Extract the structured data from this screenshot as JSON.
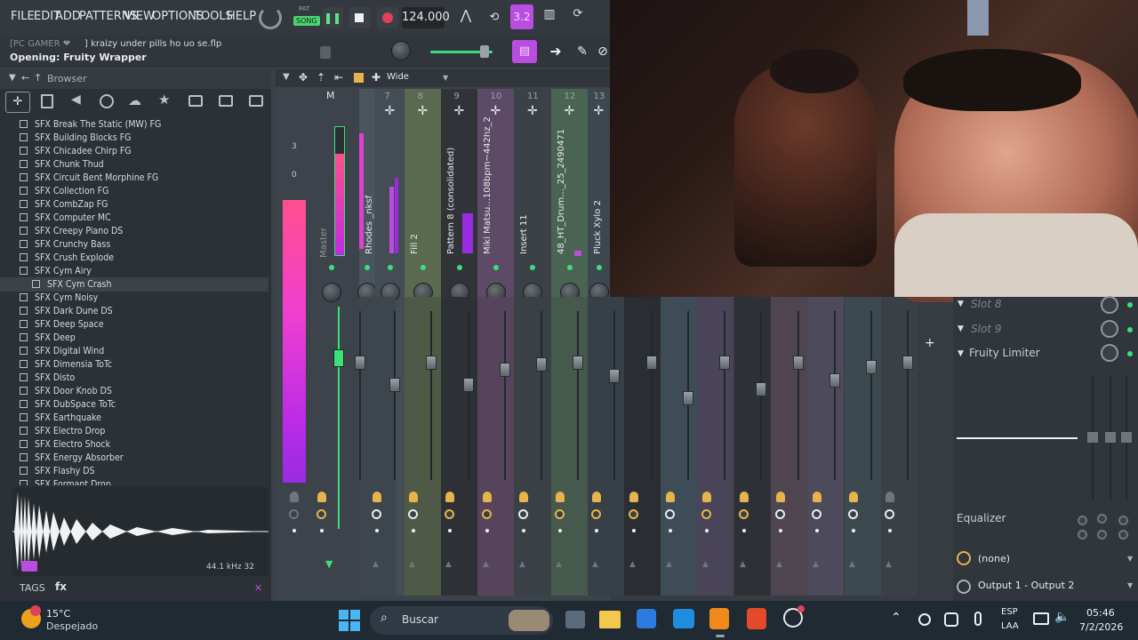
{
  "menubar": {
    "items": [
      "FILE",
      "EDIT",
      "ADD",
      "PATTERNS",
      "VIEW",
      "OPTIONS",
      "TOOLS",
      "HELP"
    ],
    "song_label": "SONG",
    "pat_label": "PAT",
    "tempo": "124.000"
  },
  "hint": {
    "user": "[PC GAMER ❤",
    "file": "] kraizy under pills ho uo se.flp",
    "status": "Opening: Fruity Wrapper"
  },
  "browser": {
    "title": "Browser",
    "items": [
      "SFX Break The Static (MW) FG",
      "SFX Building Blocks FG",
      "SFX Chicadee Chirp FG",
      "SFX Chunk Thud",
      "SFX Circuit Bent Morphine FG",
      "SFX Collection FG",
      "SFX CombZap FG",
      "SFX Computer MC",
      "SFX Creepy Piano DS",
      "SFX Crunchy Bass",
      "SFX Crush Explode",
      "SFX Cym Airy",
      "SFX Cym Crash",
      "SFX Cym Noisy",
      "SFX Dark Dune DS",
      "SFX Deep Space",
      "SFX Deep",
      "SFX Digital Wind",
      "SFX Dimensia ToTc",
      "SFX Disto",
      "SFX Door Knob DS",
      "SFX DubSpace ToTc",
      "SFX Earthquake",
      "SFX Electro Drop",
      "SFX Electro Shock",
      "SFX Energy Absorber",
      "SFX Flashy DS",
      "SFX Formant Drop"
    ],
    "selected_index": 12,
    "sample_info": "44.1 kHz 32",
    "tags_label": "TAGS",
    "fx_label": "fx"
  },
  "mixer": {
    "view_label": "Wide",
    "master_label": "M",
    "meter_scale": [
      "3",
      "0"
    ],
    "strips": [
      {
        "num": "",
        "name": "Master",
        "color": "#3c434a"
      },
      {
        "num": "",
        "name": "Rhodes _nksf",
        "color": "#4a545d"
      },
      {
        "num": "7",
        "name": "",
        "color": "#444c54"
      },
      {
        "num": "8",
        "name": "Fill 2",
        "color": "#5b6a4e"
      },
      {
        "num": "9",
        "name": "Pattern 8 (consolidated)",
        "color": "#303438"
      },
      {
        "num": "10",
        "name": "Miki Matsu...108bpm~442hz_2",
        "color": "#5d4a66"
      },
      {
        "num": "11",
        "name": "Insert 11",
        "color": "#3b4247"
      },
      {
        "num": "12",
        "name": "48_HT_Drum..._25_2490471",
        "color": "#4a6454"
      },
      {
        "num": "13",
        "name": "Pluck Xylo 2",
        "color": "#3d474e"
      }
    ]
  },
  "rightpanel": {
    "slots": [
      "Slot 8",
      "Slot 9",
      "Fruity Limiter"
    ],
    "eq_label": "Equalizer",
    "route_none": "(none)",
    "output": "Output 1 - Output 2"
  },
  "taskbar": {
    "temp": "15°C",
    "weather": "Despejado",
    "search": "Buscar",
    "lang1": "ESP",
    "lang2": "LAA",
    "time": "05:46",
    "date": "7/2/2026"
  },
  "colors": {
    "accent_purple": "#b84de0",
    "meter_pink": "#ff3fb0",
    "green": "#3be07a"
  }
}
